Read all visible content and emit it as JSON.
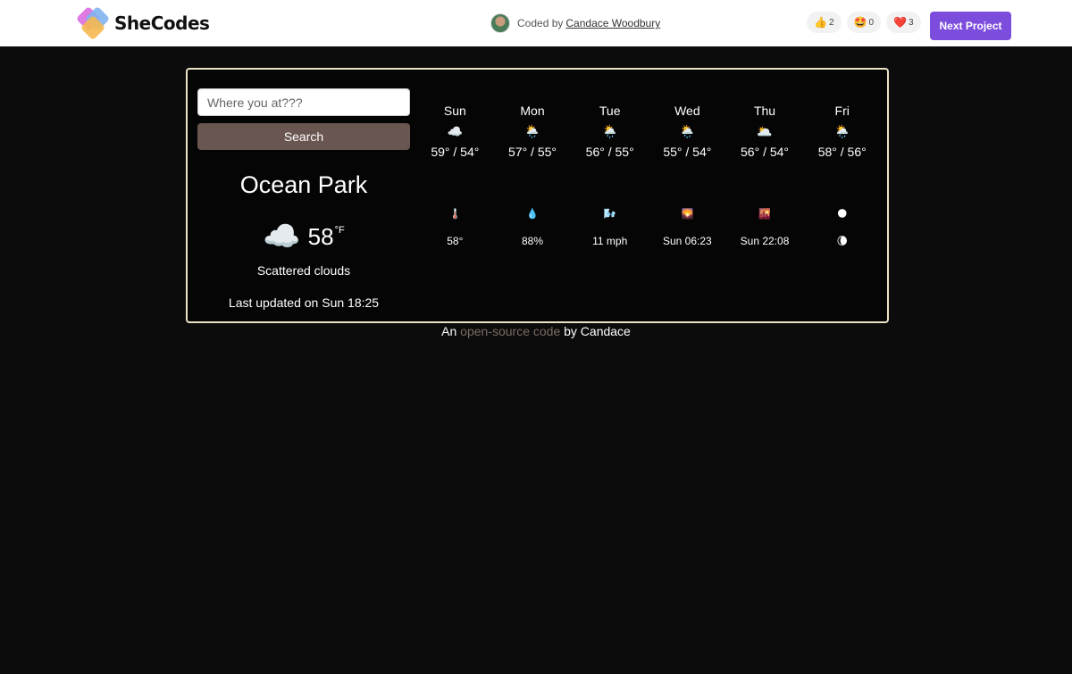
{
  "header": {
    "logo_text": "SheCodes",
    "coded_by_prefix": "Coded by",
    "author_name": "Candace Woodbury",
    "reactions": [
      {
        "icon": "👍",
        "count": "2"
      },
      {
        "icon": "🤩",
        "count": "0"
      },
      {
        "icon": "❤️",
        "count": "3"
      }
    ],
    "next_button": "Next Project"
  },
  "search": {
    "placeholder": "Where you at???",
    "button_label": "Search"
  },
  "current": {
    "city": "Ocean Park",
    "icon": "☁️",
    "temperature": "58",
    "unit": "°F",
    "description": "Scattered clouds",
    "last_updated": "Last updated on Sun 18:25"
  },
  "forecast": [
    {
      "day": "Sun",
      "icon": "☁️",
      "range": "59° / 54°"
    },
    {
      "day": "Mon",
      "icon": "🌦️",
      "range": "57° / 55°"
    },
    {
      "day": "Tue",
      "icon": "🌦️",
      "range": "56° / 55°"
    },
    {
      "day": "Wed",
      "icon": "🌦️",
      "range": "55° / 54°"
    },
    {
      "day": "Thu",
      "icon": "🌥️",
      "range": "56° / 54°"
    },
    {
      "day": "Fri",
      "icon": "🌦️",
      "range": "58° / 56°"
    }
  ],
  "details": [
    {
      "icon": "🌡️",
      "value": "58°"
    },
    {
      "icon": "💧",
      "value": "88%"
    },
    {
      "icon": "🌬️",
      "value": "11 mph"
    },
    {
      "icon": "🌄",
      "value": "Sun 06:23"
    },
    {
      "icon": "🌇",
      "value": "Sun 22:08"
    },
    {
      "icon": "🌑",
      "value": "🌘"
    }
  ],
  "footer": {
    "prefix": "An",
    "link_text": "open-source code",
    "suffix": "by Candace"
  },
  "colors": {
    "accent": "#7c4ddd",
    "search_button": "#6a5651",
    "card_border": "#ece2c6",
    "background": "#0c0c0c"
  }
}
